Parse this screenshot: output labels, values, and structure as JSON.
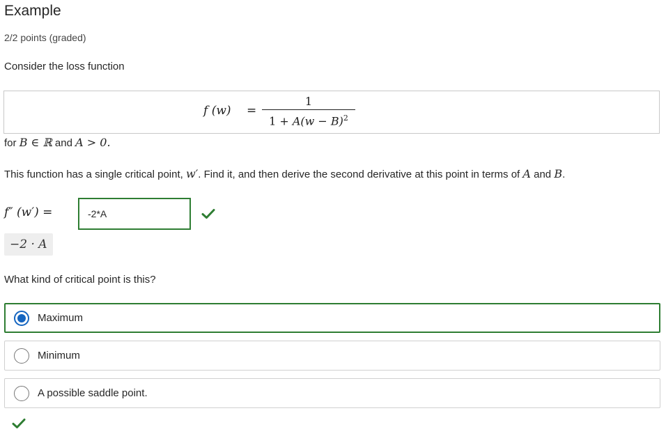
{
  "problem": {
    "title": "Example",
    "points": "2/2 points (graded)",
    "prompt": "Consider the loss function"
  },
  "equation": {
    "lhs": "f (w)",
    "equals": "=",
    "numerator": "1",
    "denominator_prefix": "1 + ",
    "denominator_var": "A(w − B)",
    "denominator_exponent": "2"
  },
  "condition": {
    "for_text": "for ",
    "math1": "B ∈ ℝ",
    "and_text": " and ",
    "math2": "A > 0."
  },
  "question1": {
    "text_before": "This function has a single critical point, ",
    "point": "w′",
    "text_after": ". Find it, and then derive the second derivative at this point in terms of ",
    "var_a": "A",
    "and_text": " and ",
    "var_b": "B",
    "period": "."
  },
  "answer": {
    "label": "f″ (w′) =",
    "input_value": "-2*A",
    "status": "correct",
    "preview": "−2 · A"
  },
  "question2": {
    "text": "What kind of critical point is this?",
    "options": [
      {
        "label": "Maximum",
        "selected": true
      },
      {
        "label": "Minimum",
        "selected": false
      },
      {
        "label": "A possible saddle point.",
        "selected": false
      }
    ],
    "status": "correct"
  },
  "colors": {
    "correct": "#2e7d32",
    "selected_radio": "#1565c0"
  }
}
